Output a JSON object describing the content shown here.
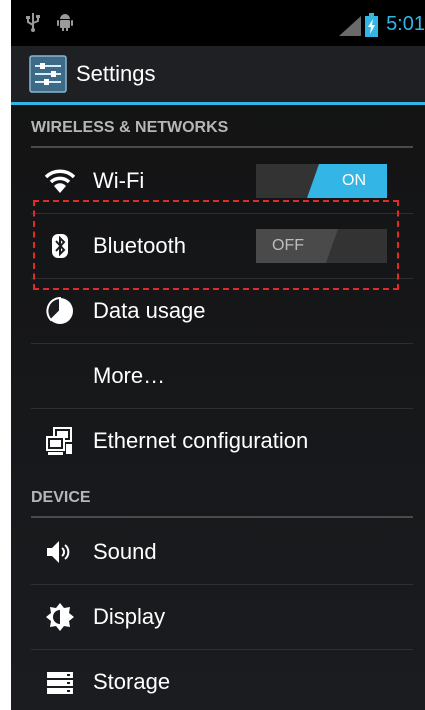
{
  "status_bar": {
    "time": "5:01",
    "icons": [
      "usb-icon",
      "android-debug-icon",
      "signal-icon",
      "battery-charging-icon"
    ]
  },
  "action_bar": {
    "title": "Settings",
    "icon": "settings-app-icon"
  },
  "sections": [
    {
      "header": "WIRELESS & NETWORKS",
      "items": [
        {
          "label": "Wi-Fi",
          "icon": "wifi-icon",
          "toggle": "ON"
        },
        {
          "label": "Bluetooth",
          "icon": "bluetooth-icon",
          "toggle": "OFF"
        },
        {
          "label": "Data usage",
          "icon": "data-usage-icon"
        },
        {
          "label": "More…"
        },
        {
          "label": "Ethernet configuration",
          "icon": "ethernet-icon"
        }
      ]
    },
    {
      "header": "DEVICE",
      "items": [
        {
          "label": "Sound",
          "icon": "sound-icon"
        },
        {
          "label": "Display",
          "icon": "display-icon"
        },
        {
          "label": "Storage",
          "icon": "storage-icon"
        }
      ]
    }
  ],
  "colors": {
    "accent": "#33b5e5",
    "background": "#1a1c20",
    "highlight": "#e02b2b"
  }
}
